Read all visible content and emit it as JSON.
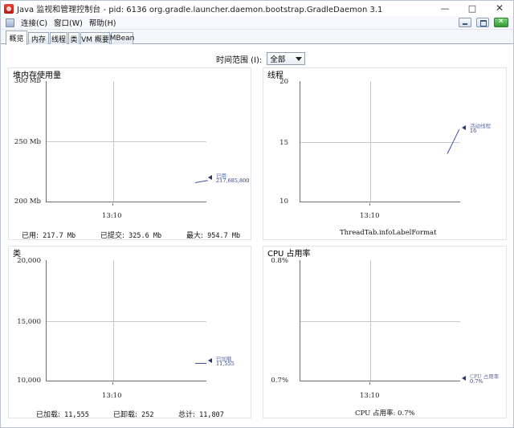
{
  "window": {
    "title": "Java 监视和管理控制台 - pid: 6136 org.gradle.launcher.daemon.bootstrap.GradleDaemon 3.1",
    "controls": {
      "minimize": "—",
      "maximize": "□",
      "close": "✕"
    }
  },
  "menubar": {
    "items": [
      "连接(C)",
      "窗口(W)",
      "帮助(H)"
    ]
  },
  "tabs": [
    "概览",
    "内存",
    "线程",
    "类",
    "VM 概要",
    "MBean"
  ],
  "time_range": {
    "label": "时间范围 (I):",
    "value": "全部"
  },
  "colors": {
    "series": "#3e4fa0",
    "grid": "#c9c9c9"
  },
  "panels": {
    "heap": {
      "title": "堆内存使用量",
      "y_ticks": [
        "300 Mb",
        "250 Mb",
        "200 Mb"
      ],
      "x_tick": "13:10",
      "legend": {
        "name": "已用",
        "value": "217,685,800"
      },
      "stats": [
        {
          "label": "已用:",
          "value": "217.7  Mb"
        },
        {
          "label": "已提交:",
          "value": "325.6  Mb"
        },
        {
          "label": "最大:",
          "value": "954.7  Mb"
        }
      ]
    },
    "threads": {
      "title": "线程",
      "y_ticks": [
        "20",
        "15",
        "10"
      ],
      "x_tick": "13:10",
      "legend": {
        "name": "活动线程",
        "value": "16"
      },
      "footer": "ThreadTab.infoLabelFormat"
    },
    "classes": {
      "title": "类",
      "y_ticks": [
        "20,000",
        "15,000",
        "10,000"
      ],
      "x_tick": "13:10",
      "legend": {
        "name": "已加载",
        "value": "11,555"
      },
      "stats": [
        {
          "label": "已加载:",
          "value": "11,555"
        },
        {
          "label": "已卸载:",
          "value": "252"
        },
        {
          "label": "总计:",
          "value": "11,807"
        }
      ]
    },
    "cpu": {
      "title": "CPU 占用率",
      "y_ticks": [
        "0.8%",
        "0.7%"
      ],
      "x_tick": "13:10",
      "legend": {
        "name": "CPU 占用率",
        "value": "0.7%"
      },
      "footer": "CPU 占用率:  0.7%"
    }
  }
}
